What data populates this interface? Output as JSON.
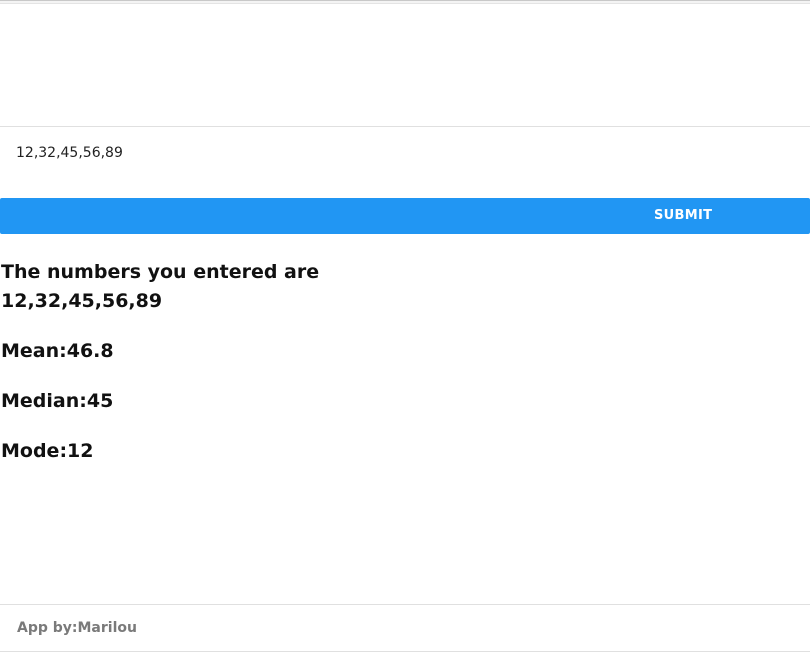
{
  "input": {
    "value": "12,32,45,56,89"
  },
  "submit": {
    "label": "SUBMIT"
  },
  "results": {
    "intro": "The numbers you entered are",
    "numbers": "12,32,45,56,89",
    "mean": "Mean:46.8",
    "median": "Median:45",
    "mode": "Mode:12"
  },
  "footer": {
    "credit": "App by:Marilou"
  },
  "colors": {
    "button_background": "#2196f3",
    "button_text": "#ffffff",
    "footer_text": "#7a7a7a"
  }
}
